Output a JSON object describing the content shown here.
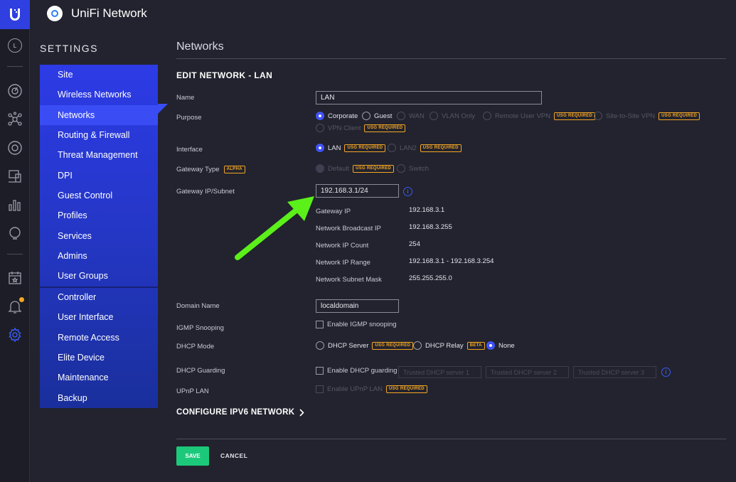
{
  "app": {
    "title": "UniFi Network",
    "logo_letter": "U",
    "brand_color": "#2f3fe0",
    "accent": "#3a4df5"
  },
  "rail": {
    "avatar_letter": "L",
    "icons": [
      "dashboard-icon",
      "topology-icon",
      "devices-icon",
      "clients-icon",
      "statistics-icon",
      "insights-icon",
      "events-icon",
      "alarms-icon",
      "settings-icon"
    ]
  },
  "settings": {
    "title": "SETTINGS",
    "items": [
      "Site",
      "Wireless Networks",
      "Networks",
      "Routing & Firewall",
      "Threat Management",
      "DPI",
      "Guest Control",
      "Profiles",
      "Services",
      "Admins",
      "User Groups",
      "Controller",
      "User Interface",
      "Remote Access",
      "Elite Device",
      "Maintenance",
      "Backup"
    ],
    "active": "Networks"
  },
  "page": {
    "title": "Networks",
    "section": "EDIT NETWORK - LAN"
  },
  "form": {
    "name": {
      "label": "Name",
      "value": "LAN"
    },
    "purpose": {
      "label": "Purpose",
      "options": {
        "corporate": "Corporate",
        "guest": "Guest",
        "wan": "WAN",
        "vlan_only": "VLAN Only",
        "remote_user_vpn": "Remote User VPN",
        "site_to_site_vpn": "Site-to-Site VPN",
        "vpn_client": "VPN Client"
      },
      "selected": "Corporate"
    },
    "badges": {
      "usg_required": "USG REQUIRED",
      "alpha": "ALPHA",
      "beta": "BETA"
    },
    "interface": {
      "label": "Interface",
      "lan": "LAN",
      "lan2": "LAN2",
      "selected": "LAN"
    },
    "gateway_type": {
      "label": "Gateway Type",
      "default": "Default",
      "switch": "Switch"
    },
    "gateway_subnet": {
      "label": "Gateway IP/Subnet",
      "value": "192.168.3.1/24"
    },
    "details": [
      {
        "label": "Gateway IP",
        "value": "192.168.3.1"
      },
      {
        "label": "Network Broadcast IP",
        "value": "192.168.3.255"
      },
      {
        "label": "Network IP Count",
        "value": "254"
      },
      {
        "label": "Network IP Range",
        "value": "192.168.3.1 - 192.168.3.254"
      },
      {
        "label": "Network Subnet Mask",
        "value": "255.255.255.0"
      }
    ],
    "domain_name": {
      "label": "Domain Name",
      "value": "localdomain"
    },
    "igmp": {
      "label": "IGMP Snooping",
      "option": "Enable IGMP snooping"
    },
    "dhcp_mode": {
      "label": "DHCP Mode",
      "server": "DHCP Server",
      "relay": "DHCP Relay",
      "none": "None",
      "selected": "None"
    },
    "dhcp_guarding": {
      "label": "DHCP Guarding",
      "option": "Enable DHCP guarding",
      "placeholders": [
        "Trusted DHCP server 1",
        "Trusted DHCP server 2",
        "Trusted DHCP server 3"
      ]
    },
    "upnp": {
      "label": "UPnP LAN",
      "option": "Enable UPnP LAN"
    }
  },
  "ipv6_link": "CONFIGURE IPV6 NETWORK",
  "buttons": {
    "save": "SAVE",
    "cancel": "CANCEL"
  },
  "annotation_arrow_color": "#5bf01a"
}
